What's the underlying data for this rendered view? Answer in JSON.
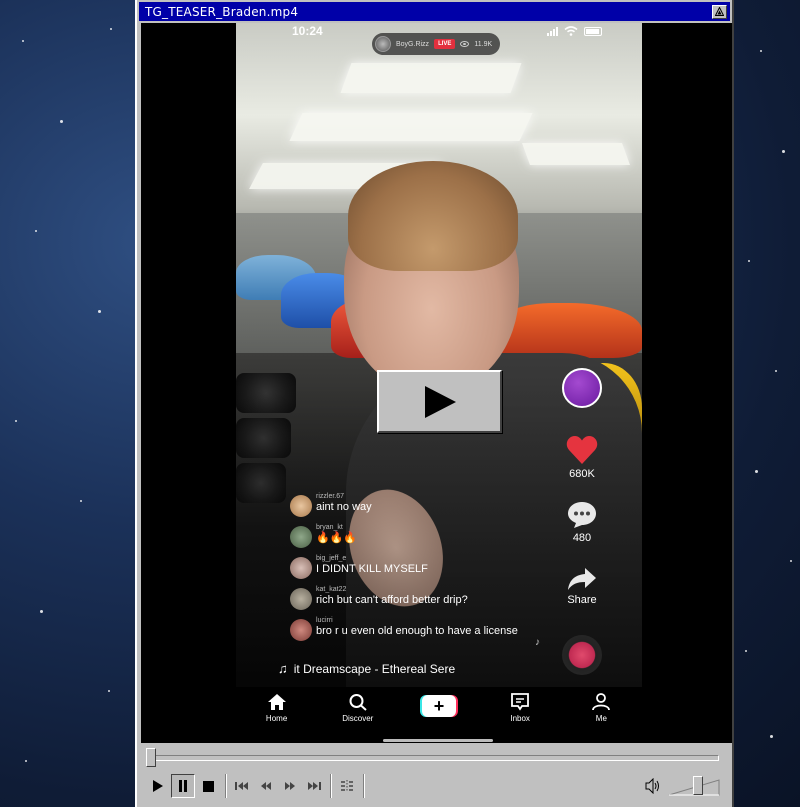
{
  "window": {
    "title": "TG_TEASER_Braden.mp4",
    "title_button_icon": "resize-icon"
  },
  "phone": {
    "status_time": "10:24",
    "live": {
      "username": "BoyG.Rizz",
      "badge": "LIVE",
      "viewers": "11.9K"
    },
    "actions": {
      "likes": "680K",
      "comments": "480",
      "share_label": "Share"
    },
    "comments": [
      {
        "user": "rizzler.67",
        "text": "aint no way"
      },
      {
        "user": "bryan_kt",
        "text": "🔥🔥🔥"
      },
      {
        "user": "big_jeff_e",
        "text": "I DIDNT KILL MYSELF"
      },
      {
        "user": "kat_kat22",
        "text": "rich but can't afford better drip?"
      },
      {
        "user": "lucirri",
        "text": "bro r u even old enough to have a license"
      }
    ],
    "music": "it Dreamscape - Ethereal Sere",
    "nav": {
      "home": "Home",
      "discover": "Discover",
      "create": "+",
      "inbox": "Inbox",
      "me": "Me"
    }
  },
  "player": {
    "seek_position": 0.0,
    "volume_level": 0.6
  },
  "colors": {
    "titlebar": "#0000a8",
    "chrome": "#c0c0c0",
    "like_red": "#e5343f",
    "live_red": "#e3303e"
  }
}
